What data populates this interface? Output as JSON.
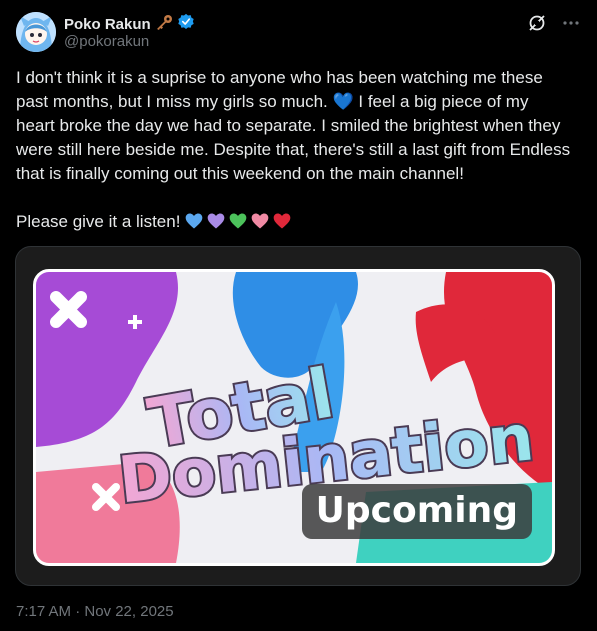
{
  "author": {
    "name": "Poko Rakun",
    "handle": "@pokorakun",
    "emoji_badge": "key-icon",
    "verified_color": "#1d9bf0"
  },
  "tweet": {
    "text": "I don't think it is a suprise to anyone who has been watching me these past months, but I miss my girls so much. 💙 I feel a big piece of my heart broke the day we had to separate. I smiled the brightest when they were still here beside me. Despite that, there's still a last gift from Endless that is finally coming out this weekend on the main channel!\n\nPlease give it a listen!",
    "hearts": [
      "💙",
      "💜",
      "💚",
      "🩷",
      "❤️"
    ],
    "timestamp": "7:17 AM · Nov 22, 2025"
  },
  "media": {
    "title_line1": "Total",
    "title_line2": "Domination",
    "badge": "Upcoming",
    "colors": {
      "purple": "#a64bd6",
      "blue": "#2f8ee6",
      "red": "#e0283a",
      "pink": "#f07a9a",
      "teal": "#3fd1c0"
    }
  },
  "actions": {
    "grok_icon": "grok-icon",
    "more_icon": "more-icon"
  }
}
